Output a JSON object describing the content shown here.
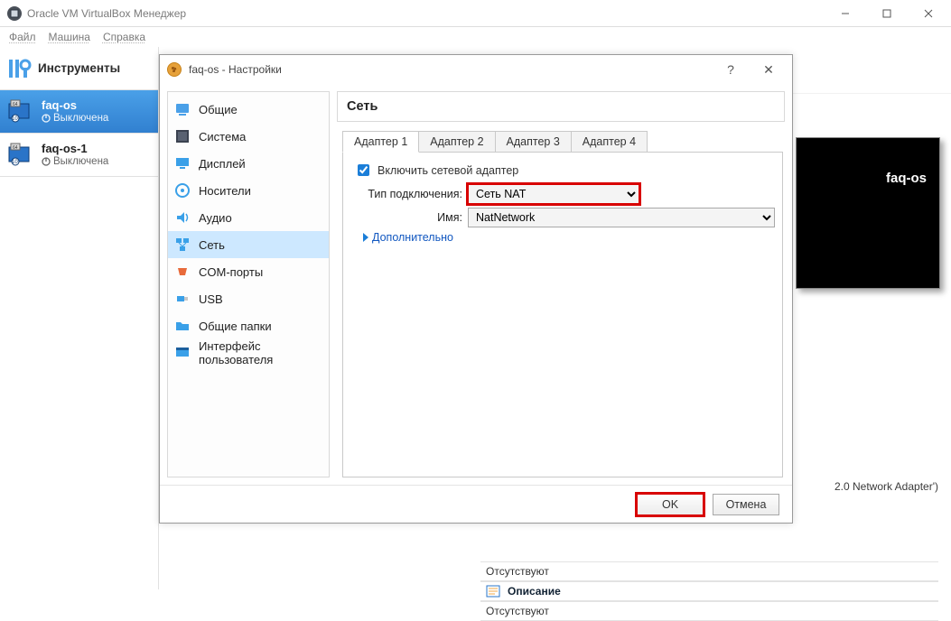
{
  "parent": {
    "title": "Oracle VM VirtualBox Менеджер",
    "menu": {
      "file": "Файл",
      "machine": "Машина",
      "help": "Справка"
    },
    "tools_label": "Инструменты"
  },
  "vms": [
    {
      "name": "faq-os",
      "state": "Выключена"
    },
    {
      "name": "faq-os-1",
      "state": "Выключена"
    }
  ],
  "preview": {
    "name": "faq-os"
  },
  "info_strip": "2.0 Network Adapter')",
  "details": {
    "absent0": "Отсутствуют",
    "desc_head": "Описание",
    "absent1": "Отсутствуют"
  },
  "dialog": {
    "title": "faq-os - Настройки",
    "categories": {
      "general": "Общие",
      "system": "Система",
      "display": "Дисплей",
      "storage": "Носители",
      "audio": "Аудио",
      "network": "Сеть",
      "serial": "COM-порты",
      "usb": "USB",
      "shared": "Общие папки",
      "ui": "Интерфейс пользователя"
    },
    "section_title": "Сеть",
    "tabs": [
      "Адаптер 1",
      "Адаптер 2",
      "Адаптер 3",
      "Адаптер 4"
    ],
    "enable_label": "Включить сетевой адаптер",
    "attach_label": "Тип подключения:",
    "attach_value": "Сеть NAT",
    "name_label": "Имя:",
    "name_value": "NatNetwork",
    "advanced_label": "Дополнительно",
    "ok": "OK",
    "cancel": "Отмена"
  }
}
